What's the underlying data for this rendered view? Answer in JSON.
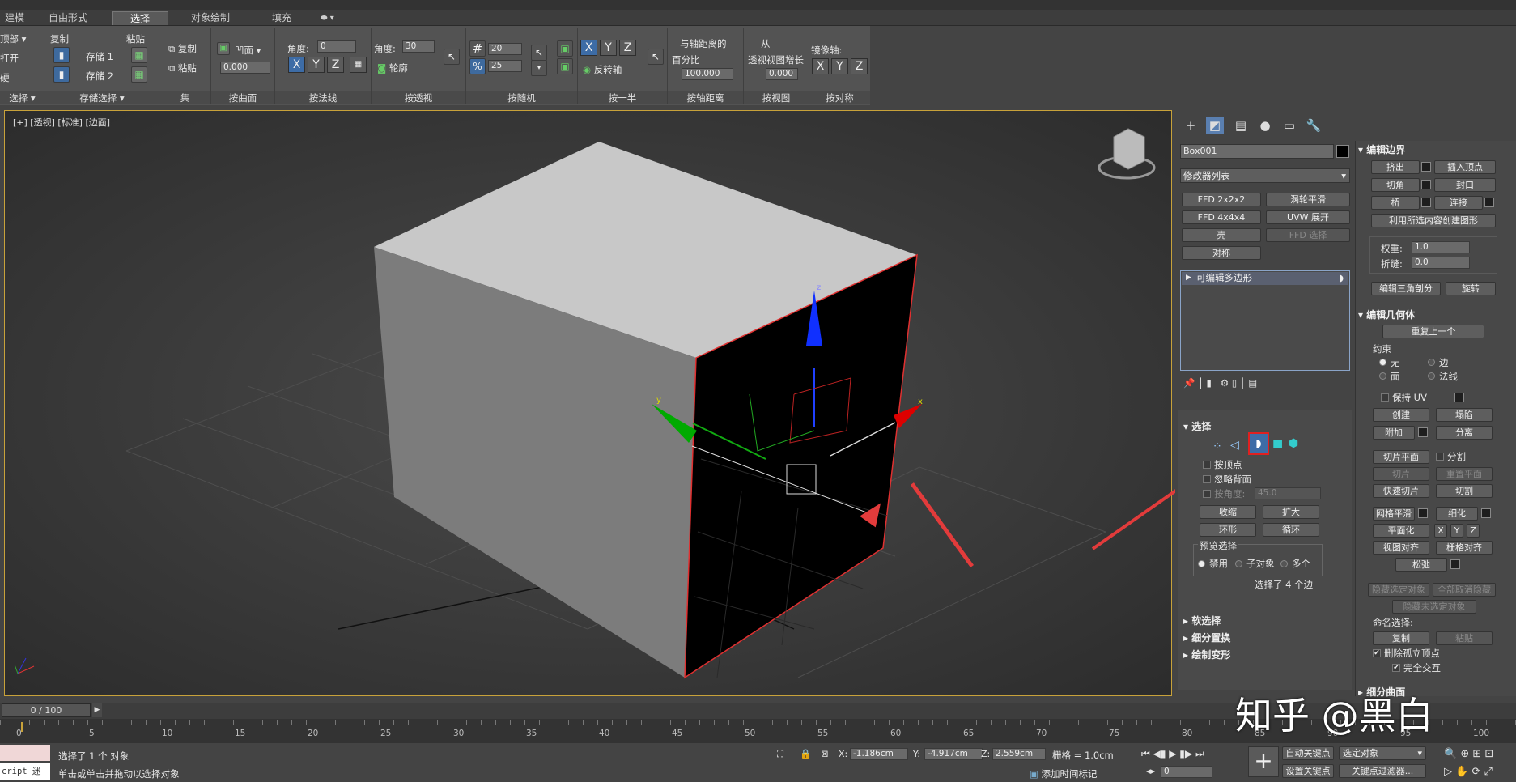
{
  "ribbon_tabs": [
    "建模",
    "自由形式",
    "选择",
    "对象绘制",
    "填充"
  ],
  "ribbon": {
    "g1": {
      "top": "顶部",
      "open": "打开",
      "hard": "硬",
      "label": "选择"
    },
    "g2": {
      "copy": "复制",
      "paste": "粘贴",
      "store1": "存储 1",
      "store2": "存储 2",
      "label": "存储选择"
    },
    "g3": {
      "copy": "复制",
      "paste": "粘贴",
      "label": "集"
    },
    "g4": {
      "concave": "凹面",
      "value": "0.000",
      "label": "按曲面"
    },
    "g5": {
      "angle": "角度:",
      "angle_val": "0",
      "label": "按法线"
    },
    "g6": {
      "angle": "角度:",
      "angle_val": "30",
      "outline": "轮廓",
      "label": "按透视"
    },
    "g7": {
      "v1": "20",
      "v2": "25",
      "label": "按随机"
    },
    "g8": {
      "flip": "反转轴",
      "label": "按一半"
    },
    "g9": {
      "t1": "与轴距离的",
      "t2": "百分比",
      "value": "100.000",
      "label": "按轴距离"
    },
    "g10": {
      "t1": "从",
      "t2": "透视视图增长",
      "value": "0.000",
      "label": "按视图"
    },
    "g11": {
      "t1": "镜像轴:",
      "label": "按对称"
    }
  },
  "viewport": {
    "label": "[+] [透视] [标准] [边面]"
  },
  "cmd": {
    "object_name": "Box001",
    "modifier_list": "修改器列表",
    "mod_buttons": [
      "FFD 2x2x2",
      "涡轮平滑",
      "FFD 4x4x4",
      "UVW 展开",
      "壳",
      "FFD 选择",
      "对称"
    ],
    "stack_item": "可编辑多边形",
    "sel_head": "选择",
    "by_vertex": "按顶点",
    "ignore_back": "忽略背面",
    "by_angle": "按角度:",
    "angle_val": "45.0",
    "shrink": "收缩",
    "grow": "扩大",
    "ring": "环形",
    "loop": "循环",
    "preview": "预览选择",
    "disabled": "禁用",
    "subobj": "子对象",
    "multi": "多个",
    "sel_count": "选择了 4 个边",
    "soft": "软选择",
    "subdiv": "细分置换",
    "paint": "绘制变形"
  },
  "edit_border": {
    "head": "编辑边界",
    "extrude": "挤出",
    "insert_vertex": "插入顶点",
    "chamfer": "切角",
    "cap": "封口",
    "bridge": "桥",
    "connect": "连接",
    "create_shape": "利用所选内容创建图形",
    "weight": "权重:",
    "weight_val": "1.0",
    "crease": "折缝:",
    "crease_val": "0.0",
    "edit_tri": "编辑三角剖分",
    "turn": "旋转"
  },
  "edit_geom": {
    "head": "编辑几何体",
    "repeat": "重复上一个",
    "constraint": "约束",
    "none": "无",
    "edge": "边",
    "face": "面",
    "normal": "法线",
    "keep_uv": "保持 UV",
    "create": "创建",
    "collapse": "塌陷",
    "attach": "附加",
    "detach": "分离",
    "slice_plane": "切片平面",
    "split": "分割",
    "slice": "切片",
    "reset_plane": "重置平面",
    "quickslice": "快速切片",
    "cut": "切割",
    "meshsmooth": "网格平滑",
    "tessellate": "细化",
    "planarize": "平面化",
    "x": "X",
    "y": "Y",
    "z": "Z",
    "view_align": "视图对齐",
    "grid_align": "栅格对齐",
    "relax": "松弛",
    "hide_sel": "隐藏选定对象",
    "unhide_all": "全部取消隐藏",
    "hide_unsel": "隐藏未选定对象",
    "named_sel": "命名选择:",
    "copy": "复制",
    "paste": "粘贴",
    "del_iso": "删除孤立顶点",
    "full_inter": "完全交互",
    "subdiv_surface": "细分曲面"
  },
  "timeline": {
    "frame": "0 / 100",
    "ticks": [
      "0",
      "5",
      "10",
      "15",
      "20",
      "25",
      "30",
      "35",
      "40",
      "45",
      "50",
      "55",
      "60",
      "65",
      "70",
      "75",
      "80",
      "85",
      "90",
      "95",
      "100"
    ]
  },
  "status": {
    "script": "cript 迷",
    "line1": "选择了 1 个 对象",
    "line2": "单击或单击并拖动以选择对象",
    "x": "-1.186cm",
    "y": "-4.917cm",
    "z": "2.559cm",
    "grid": "栅格 = 1.0cm",
    "add_tag": "添加时间标记",
    "auto_key": "自动关键点",
    "sel_obj": "选定对象",
    "set_key": "设置关键点",
    "key_filter": "关键点过滤器...",
    "frame_val": "0"
  },
  "watermark": "知乎 @黑白",
  "colors": {
    "accent": "#3d6ca6",
    "highlight": "#e23b3b",
    "viewport_border": "#c8a23a"
  }
}
